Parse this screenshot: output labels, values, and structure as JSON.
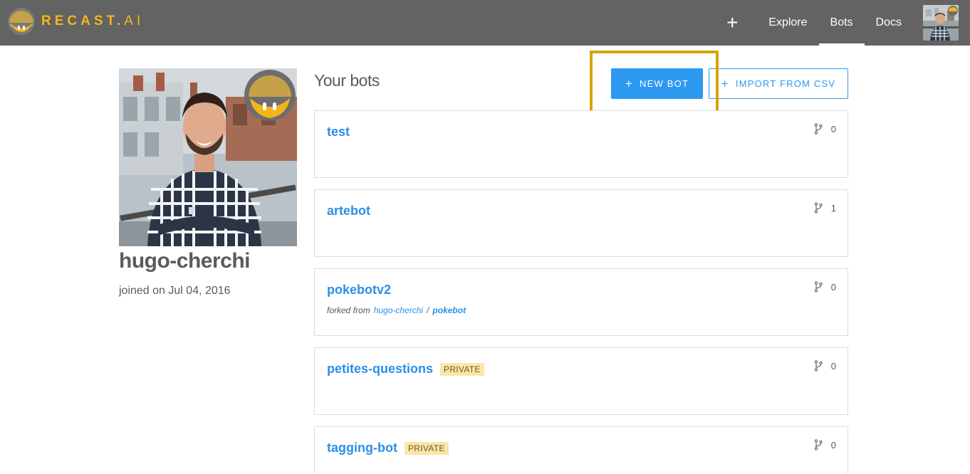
{
  "header": {
    "brand": {
      "name": "RECAST",
      "dot": ".",
      "suffix": "AI"
    },
    "plus_label": "+",
    "nav": [
      {
        "label": "Explore",
        "active": false
      },
      {
        "label": "Bots",
        "active": true
      },
      {
        "label": "Docs",
        "active": false
      }
    ]
  },
  "profile": {
    "username": "hugo-cherchi",
    "joined": "joined on Jul 04, 2016"
  },
  "bots_section": {
    "title": "Your bots",
    "new_bot_label": "NEW BOT",
    "import_label": "IMPORT FROM CSV",
    "plus_glyph": "+"
  },
  "bots": [
    {
      "name": "test",
      "forks": "0",
      "private": false
    },
    {
      "name": "artebot",
      "forks": "1",
      "private": false
    },
    {
      "name": "pokebotv2",
      "forks": "0",
      "private": false,
      "forked_from": {
        "prefix": "forked from",
        "user": "hugo-cherchi",
        "separator": "/",
        "bot": "pokebot"
      }
    },
    {
      "name": "petites-questions",
      "forks": "0",
      "private": true,
      "badge": "PRIVATE"
    },
    {
      "name": "tagging-bot",
      "forks": "0",
      "private": true,
      "badge": "PRIVATE"
    }
  ],
  "colors": {
    "topbar": "#636363",
    "brand": "#f3b51b",
    "accent": "#2d98f0",
    "highlight": "#d5a30b",
    "private_badge": "#fbe6a8"
  },
  "icons": {
    "logo": "recast-logo-icon",
    "fork": "fork-icon"
  }
}
